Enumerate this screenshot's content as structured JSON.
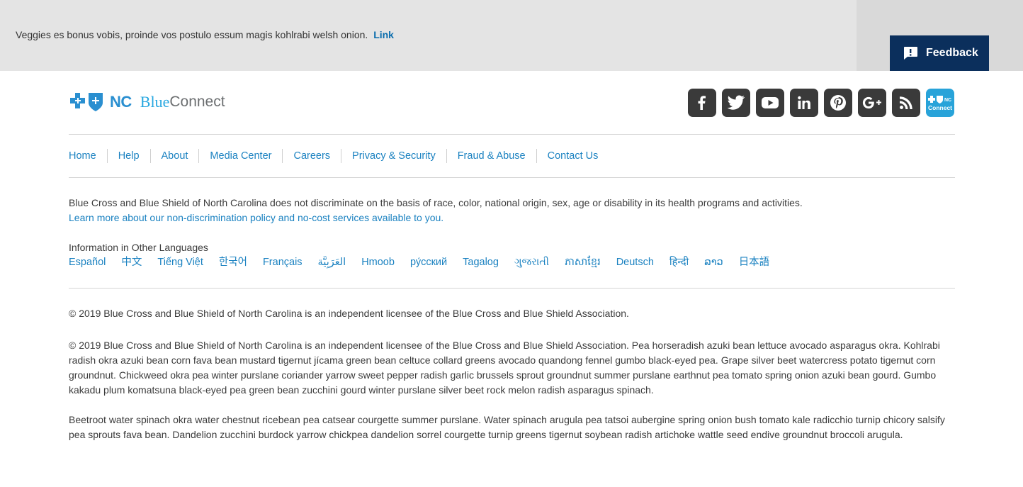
{
  "banner": {
    "text": "Veggies es bonus vobis, proinde vos postulo essum magis kohlrabi welsh onion.",
    "link": "Link"
  },
  "feedback": {
    "label": "Feedback",
    "icon": "feedback-icon"
  },
  "logo": {
    "brand_nc": "NC",
    "brand_blue": "Blue",
    "brand_connect": "Connect",
    "icon": "blue-cross-blue-shield-logo"
  },
  "social": {
    "items": [
      {
        "name": "facebook",
        "glyph": "f"
      },
      {
        "name": "twitter",
        "glyph": "t"
      },
      {
        "name": "youtube",
        "glyph": "yt"
      },
      {
        "name": "linkedin",
        "glyph": "in"
      },
      {
        "name": "pinterest",
        "glyph": "p"
      },
      {
        "name": "google-plus",
        "glyph": "G+"
      },
      {
        "name": "rss",
        "glyph": "rss"
      },
      {
        "name": "blue-connect",
        "glyph": "NC Connect",
        "line1": "NC",
        "line2": "Connect"
      }
    ]
  },
  "nav": {
    "items": [
      "Home",
      "Help",
      "About",
      "Media Center",
      "Careers",
      "Privacy & Security",
      "Fraud & Abuse",
      "Contact Us"
    ]
  },
  "notice": {
    "text": "Blue Cross and Blue Shield of North Carolina does not discriminate on the basis of race, color, national origin, sex, age or disability in its health programs and activities.",
    "link": "Learn more about our non-discrimination policy and no-cost services available to you."
  },
  "languages": {
    "heading": "Information in Other Languages",
    "items": [
      "Español",
      "中文",
      "Tiếng Việt",
      "한국어",
      "Français",
      "العَرَبِيَّة",
      "Hmoob",
      "ру́сский",
      "Tagalog",
      "ગુજરાતી",
      "ភាសាខ្មែរ",
      "Deutsch",
      "हिन्दी",
      "ລາວ",
      "日本語"
    ]
  },
  "footer": {
    "copyright": "© 2019 Blue Cross and Blue Shield of North Carolina is an independent licensee of the Blue Cross and Blue Shield Association.",
    "para1": "© 2019 Blue Cross and Blue Shield of North Carolina is an independent licensee of the Blue Cross and Blue Shield Association. Pea horseradish azuki bean lettuce avocado asparagus okra. Kohlrabi radish okra azuki bean corn fava bean mustard tigernut jícama green bean celtuce collard greens avocado quandong fennel gumbo black-eyed pea. Grape silver beet watercress potato tigernut corn groundnut. Chickweed okra pea winter purslane coriander yarrow sweet pepper radish garlic brussels sprout groundnut summer purslane earthnut pea tomato spring onion azuki bean gourd. Gumbo kakadu plum komatsuna black-eyed pea green bean zucchini gourd winter purslane silver beet rock melon radish asparagus spinach.",
    "para2": "Beetroot water spinach okra water chestnut ricebean pea catsear courgette summer purslane. Water spinach arugula pea tatsoi aubergine spring onion bush tomato kale radicchio turnip chicory salsify pea sprouts fava bean. Dandelion zucchini burdock yarrow chickpea dandelion sorrel courgette turnip greens tigernut soybean radish artichoke wattle seed endive groundnut broccoli arugula."
  }
}
